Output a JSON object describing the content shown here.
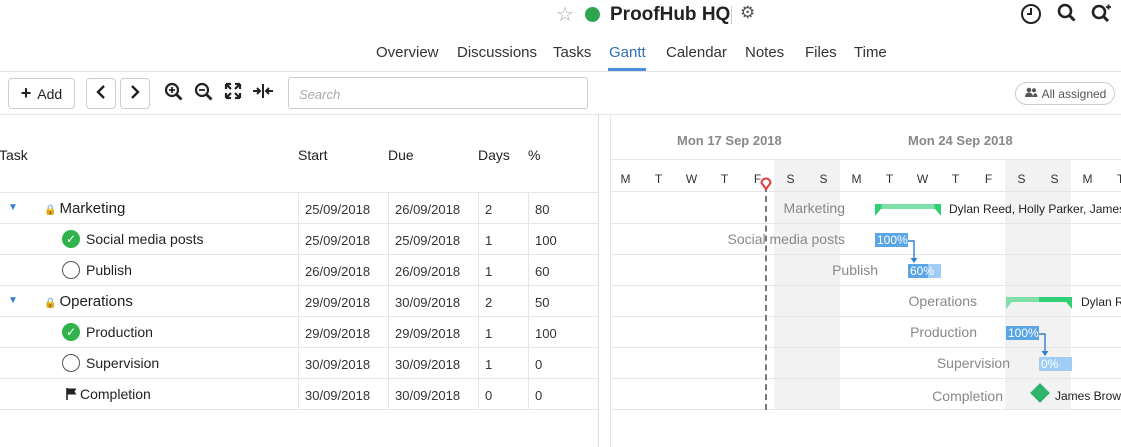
{
  "header": {
    "project_title": "ProofHub HQ",
    "status_color": "#2fa44f",
    "icons": [
      "star-icon",
      "gear-icon",
      "clock-icon",
      "search-icon",
      "quick-add-icon"
    ],
    "tabs": [
      {
        "label": "Overview"
      },
      {
        "label": "Discussions"
      },
      {
        "label": "Tasks"
      },
      {
        "label": "Gantt"
      },
      {
        "label": "Calendar"
      },
      {
        "label": "Notes"
      },
      {
        "label": "Files"
      },
      {
        "label": "Time"
      }
    ],
    "active_tab": "Gantt"
  },
  "toolbar": {
    "add_label": "Add",
    "search_placeholder": "Search",
    "assigned_label": "All assigned",
    "icons": [
      "plus-icon",
      "chevron-left-icon",
      "chevron-right-icon",
      "zoom-in-icon",
      "zoom-out-icon",
      "expand-icon",
      "collapse-icon",
      "users-icon"
    ]
  },
  "table": {
    "columns": [
      "Task",
      "Start",
      "Due",
      "Days",
      "%"
    ],
    "rows": [
      {
        "name": "Marketing",
        "type": "group",
        "start": "25/09/2018",
        "due": "26/09/2018",
        "days": "2",
        "pct": "80"
      },
      {
        "name": "Social media posts",
        "type": "done",
        "start": "25/09/2018",
        "due": "25/09/2018",
        "days": "1",
        "pct": "100"
      },
      {
        "name": "Publish",
        "type": "open",
        "start": "26/09/2018",
        "due": "26/09/2018",
        "days": "1",
        "pct": "60"
      },
      {
        "name": "Operations",
        "type": "group",
        "start": "29/09/2018",
        "due": "30/09/2018",
        "days": "2",
        "pct": "50"
      },
      {
        "name": "Production",
        "type": "done",
        "start": "29/09/2018",
        "due": "29/09/2018",
        "days": "1",
        "pct": "100"
      },
      {
        "name": "Supervision",
        "type": "open",
        "start": "30/09/2018",
        "due": "30/09/2018",
        "days": "1",
        "pct": "0"
      },
      {
        "name": "Completion",
        "type": "milestone",
        "start": "30/09/2018",
        "due": "30/09/2018",
        "days": "0",
        "pct": "0"
      }
    ]
  },
  "gantt": {
    "weeks": [
      "Mon 17 Sep 2018",
      "Mon 24 Sep 2018"
    ],
    "days": [
      "M",
      "T",
      "W",
      "T",
      "F",
      "S",
      "S",
      "M",
      "T",
      "W",
      "T",
      "F",
      "S",
      "S",
      "M",
      "T"
    ],
    "labels": {
      "marketing": "Marketing",
      "marketing_assignees": "Dylan Reed, Holly Parker, James B",
      "social": "Social media posts",
      "social_pct": "100%",
      "publish": "Publish",
      "publish_pct": "60%",
      "operations": "Operations",
      "operations_assignees": "Dylan R",
      "production": "Production",
      "production_pct": "100%",
      "supervision": "Supervision",
      "supervision_pct": "0%",
      "completion": "Completion",
      "completion_assignee": "James Brown"
    },
    "colors": {
      "today_marker": "#e23c3c",
      "summary_bar": "#7ee0a8",
      "progress_bar": "#5aa5e6",
      "remaining_bar": "#9fcdf4",
      "milestone": "#2fb36b"
    }
  }
}
